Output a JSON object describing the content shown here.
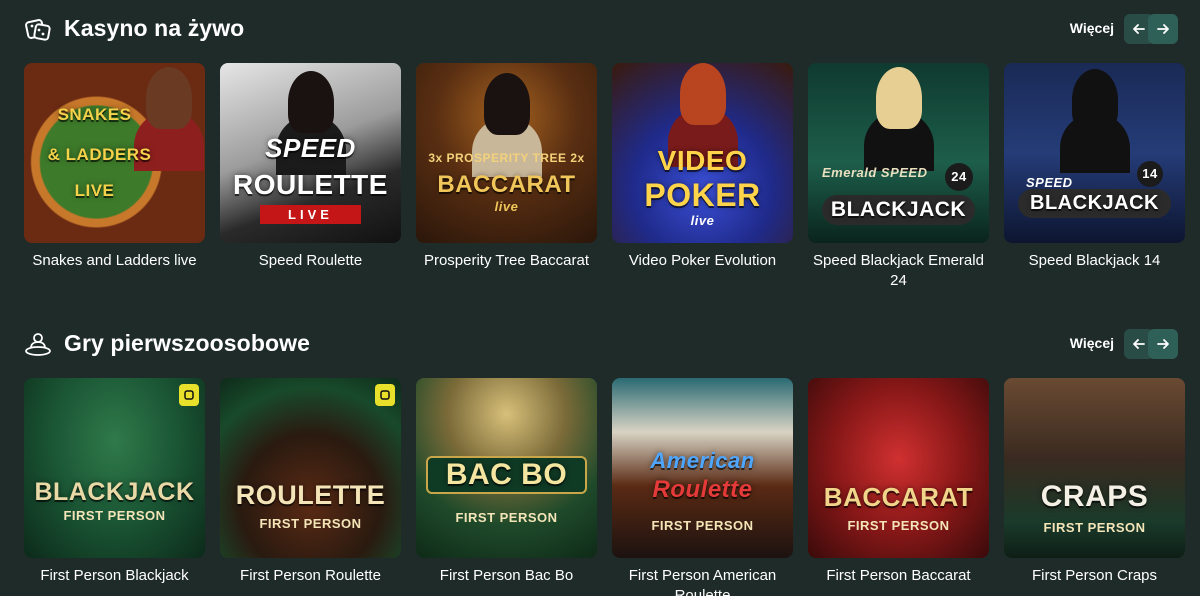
{
  "sections": [
    {
      "title": "Kasyno na żywo",
      "icon": "dice-icon",
      "more_label": "Więcej",
      "cards": [
        {
          "label": "Snakes and Ladders live",
          "thumb_lines": [
            "SNAKES",
            "& LADDERS",
            "LIVE"
          ]
        },
        {
          "label": "Speed Roulette",
          "thumb_lines": [
            "SPEED",
            "ROULETTE",
            "LIVE"
          ]
        },
        {
          "label": "Prosperity Tree Baccarat",
          "thumb_lines": [
            "3x PROSPERITY TREE 2x",
            "BACCARAT",
            "live"
          ]
        },
        {
          "label": "Video Poker Evolution",
          "thumb_lines": [
            "VIDEO",
            "POKER",
            "live"
          ]
        },
        {
          "label": "Speed Blackjack Emerald 24",
          "thumb_lines": [
            "Emerald SPEED",
            "BLACKJACK",
            "24"
          ]
        },
        {
          "label": "Speed Blackjack 14",
          "thumb_lines": [
            "SPEED",
            "BLACKJACK",
            "14"
          ]
        }
      ]
    },
    {
      "title": "Gry pierwszoosobowe",
      "icon": "first-person-icon",
      "more_label": "Więcej",
      "cards": [
        {
          "label": "First Person Blackjack",
          "thumb_lines": [
            "BLACKJACK",
            "FIRST PERSON"
          ]
        },
        {
          "label": "First Person Roulette",
          "thumb_lines": [
            "ROULETTE",
            "FIRST PERSON"
          ]
        },
        {
          "label": "First Person Bac Bo",
          "thumb_lines": [
            "BAC BO",
            "FIRST PERSON"
          ]
        },
        {
          "label": "First Person American Roulette",
          "thumb_lines": [
            "American",
            "Roulette",
            "FIRST PERSON"
          ]
        },
        {
          "label": "First Person Baccarat",
          "thumb_lines": [
            "BACCARAT",
            "FIRST PERSON"
          ]
        },
        {
          "label": "First Person Craps",
          "thumb_lines": [
            "CRAPS",
            "FIRST PERSON"
          ]
        }
      ]
    }
  ],
  "colors": {
    "background": "#1e2b29",
    "nav_button": "#2d5a53",
    "badge": "#e8e02a"
  }
}
